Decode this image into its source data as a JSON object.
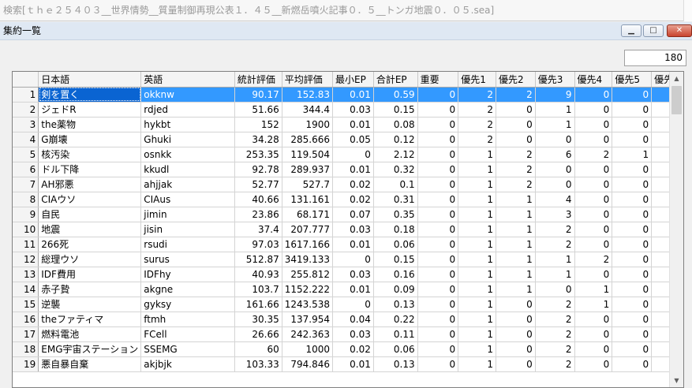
{
  "search": {
    "text": "検索[ｔｈｅ２５４０３__世界情勢__質量制御再現公表１．４５__新燃岳噴火記事０．５__トンガ地震０．０５.sea]"
  },
  "window": {
    "title": "集約一覧",
    "minimize_glyph": "▁",
    "maximize_glyph": "□",
    "close_glyph": "✕"
  },
  "count": "180",
  "table": {
    "columns": [
      "",
      "日本語",
      "英語",
      "統計評価",
      "平均評価",
      "最小EP",
      "合計EP",
      "重要",
      "優先1",
      "優先2",
      "優先3",
      "優先4",
      "優先5",
      "優先"
    ],
    "rows": [
      [
        "1",
        "剣を置く",
        "okknw",
        "90.17",
        "152.83",
        "0.01",
        "0.59",
        "0",
        "2",
        "2",
        "9",
        "0",
        "0",
        ""
      ],
      [
        "2",
        "ジェドR",
        "rdjed",
        "51.66",
        "344.4",
        "0.03",
        "0.15",
        "0",
        "2",
        "0",
        "1",
        "0",
        "0",
        ""
      ],
      [
        "3",
        "the薬物",
        "hykbt",
        "152",
        "1900",
        "0.01",
        "0.08",
        "0",
        "2",
        "0",
        "1",
        "0",
        "0",
        ""
      ],
      [
        "4",
        "G崩壊",
        "Ghuki",
        "34.28",
        "285.666",
        "0.05",
        "0.12",
        "0",
        "2",
        "0",
        "0",
        "0",
        "0",
        ""
      ],
      [
        "5",
        "核汚染",
        "osnkk",
        "253.35",
        "119.504",
        "0",
        "2.12",
        "0",
        "1",
        "2",
        "6",
        "2",
        "1",
        ""
      ],
      [
        "6",
        "ドル下降",
        "kkudl",
        "92.78",
        "289.937",
        "0.01",
        "0.32",
        "0",
        "1",
        "2",
        "0",
        "0",
        "0",
        ""
      ],
      [
        "7",
        "AH邪悪",
        "ahjjak",
        "52.77",
        "527.7",
        "0.02",
        "0.1",
        "0",
        "1",
        "2",
        "0",
        "0",
        "0",
        ""
      ],
      [
        "8",
        "CIAウソ",
        "CIAus",
        "40.66",
        "131.161",
        "0.02",
        "0.31",
        "0",
        "1",
        "1",
        "4",
        "0",
        "0",
        ""
      ],
      [
        "9",
        "自民",
        "jimin",
        "23.86",
        "68.171",
        "0.07",
        "0.35",
        "0",
        "1",
        "1",
        "3",
        "0",
        "0",
        ""
      ],
      [
        "10",
        "地震",
        "jisin",
        "37.4",
        "207.777",
        "0.03",
        "0.18",
        "0",
        "1",
        "1",
        "2",
        "0",
        "0",
        ""
      ],
      [
        "11",
        "266死",
        "rsudi",
        "97.03",
        "1617.166",
        "0.01",
        "0.06",
        "0",
        "1",
        "1",
        "2",
        "0",
        "0",
        ""
      ],
      [
        "12",
        "総理ウソ",
        "surus",
        "512.87",
        "3419.133",
        "0",
        "0.15",
        "0",
        "1",
        "1",
        "1",
        "2",
        "0",
        ""
      ],
      [
        "13",
        "IDF費用",
        "IDFhy",
        "40.93",
        "255.812",
        "0.03",
        "0.16",
        "0",
        "1",
        "1",
        "1",
        "0",
        "0",
        ""
      ],
      [
        "14",
        "赤子贄",
        "akgne",
        "103.7",
        "1152.222",
        "0.01",
        "0.09",
        "0",
        "1",
        "1",
        "0",
        "1",
        "0",
        ""
      ],
      [
        "15",
        "逆襲",
        "gyksy",
        "161.66",
        "1243.538",
        "0",
        "0.13",
        "0",
        "1",
        "0",
        "2",
        "1",
        "0",
        ""
      ],
      [
        "16",
        "theファティマ",
        "ftmh",
        "30.35",
        "137.954",
        "0.04",
        "0.22",
        "0",
        "1",
        "0",
        "2",
        "0",
        "0",
        ""
      ],
      [
        "17",
        "燃料電池",
        "FCell",
        "26.66",
        "242.363",
        "0.03",
        "0.11",
        "0",
        "1",
        "0",
        "2",
        "0",
        "0",
        ""
      ],
      [
        "18",
        "EMG宇宙ステーション",
        "SSEMG",
        "60",
        "1000",
        "0.02",
        "0.06",
        "0",
        "1",
        "0",
        "2",
        "0",
        "0",
        ""
      ],
      [
        "19",
        "悪自暴自棄",
        "akjbjk",
        "103.33",
        "794.846",
        "0.01",
        "0.13",
        "0",
        "1",
        "0",
        "2",
        "0",
        "0",
        ""
      ]
    ]
  },
  "scrollbar": {
    "up_glyph": "▲",
    "down_glyph": "▼"
  }
}
